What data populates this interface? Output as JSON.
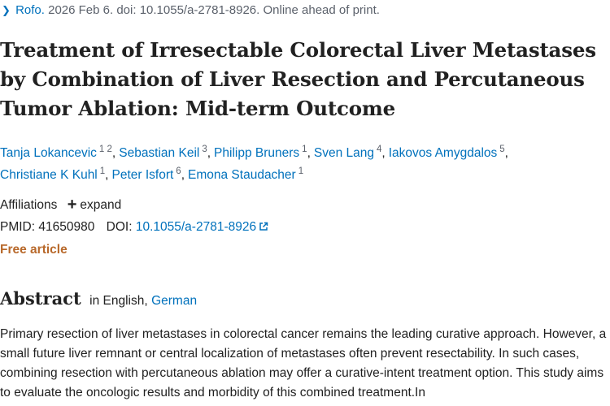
{
  "citation": {
    "journal": "Rofo.",
    "details": "2026 Feb 6. doi: 10.1055/a-2781-8926. Online ahead of print."
  },
  "title": "Treatment of Irresectable Colorectal Liver Metastases by Combination of Liver Resection and Percutaneous Tumor Ablation: Mid-term Outcome",
  "authors": [
    {
      "name": "Tanja Lokancevic",
      "aff": "1 2"
    },
    {
      "name": "Sebastian Keil",
      "aff": "3"
    },
    {
      "name": "Philipp Bruners",
      "aff": "1"
    },
    {
      "name": "Sven Lang",
      "aff": "4"
    },
    {
      "name": "Iakovos Amygdalos",
      "aff": "5"
    },
    {
      "name": "Christiane K Kuhl",
      "aff": "1"
    },
    {
      "name": "Peter Isfort",
      "aff": "6"
    },
    {
      "name": "Emona Staudacher",
      "aff": "1"
    }
  ],
  "affiliations": {
    "label": "Affiliations",
    "expand": "expand"
  },
  "ids": {
    "pmid_label": "PMID:",
    "pmid": "41650980",
    "doi_label": "DOI:",
    "doi": "10.1055/a-2781-8926"
  },
  "free_article": "Free article",
  "abstract": {
    "heading": "Abstract",
    "lang_prefix": "in English,",
    "lang_link": "German",
    "text": "Primary resection of liver metastases in colorectal cancer remains the leading curative approach. However, a small future liver remnant or central localization of metastases often prevent resectability. In such cases, combining resection with percutaneous ablation may offer a curative-intent treatment option. This study aims to evaluate the oncologic results and morbidity of this combined treatment.In"
  },
  "colors": {
    "link": "#0071bc",
    "free_article": "#b8692b",
    "text": "#212121",
    "muted": "#5b616b"
  }
}
